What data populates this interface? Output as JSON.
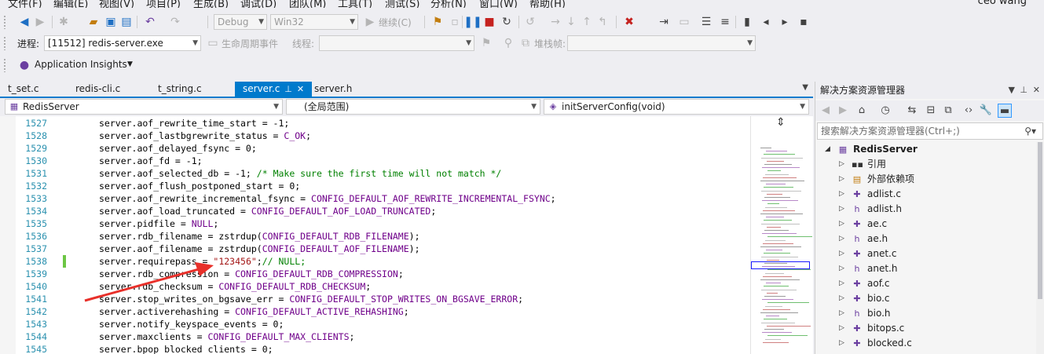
{
  "menu": {
    "items": [
      "文件(F)",
      "编辑(E)",
      "视图(V)",
      "项目(P)",
      "生成(B)",
      "调试(D)",
      "团队(M)",
      "工具(T)",
      "测试(S)",
      "分析(N)",
      "窗口(W)",
      "帮助(H)"
    ],
    "user": "ceo wang"
  },
  "toolbar": {
    "config_value": "Debug",
    "platform_value": "Win32",
    "continue_label": "继续(C)",
    "process_label": "进程:",
    "process_value": "[11512] redis-server.exe",
    "lifecycle_label": "生命周期事件",
    "thread_label": "线程:",
    "stack_label": "堆栈帧:",
    "insights_label": "Application Insights"
  },
  "tabs": [
    {
      "label": "t_set.c",
      "active": false
    },
    {
      "label": "redis-cli.c",
      "active": false
    },
    {
      "label": "t_string.c",
      "active": false
    },
    {
      "label": "server.c",
      "active": true
    },
    {
      "label": "server.h",
      "active": false
    }
  ],
  "navbar": {
    "project": "RedisServer",
    "scope": "(全局范围)",
    "function": "initServerConfig(void)"
  },
  "editor": {
    "lines": [
      {
        "num": "1527",
        "parts": [
          {
            "t": "server.aof_rewrite_time_start = -1;",
            "c": "n"
          }
        ]
      },
      {
        "num": "1528",
        "parts": [
          {
            "t": "server.aof_lastbgrewrite_status = ",
            "c": "n"
          },
          {
            "t": "C_OK",
            "c": "m"
          },
          {
            "t": ";",
            "c": "n"
          }
        ]
      },
      {
        "num": "1529",
        "parts": [
          {
            "t": "server.aof_delayed_fsync = 0;",
            "c": "n"
          }
        ]
      },
      {
        "num": "1530",
        "parts": [
          {
            "t": "server.aof_fd = -1;",
            "c": "n"
          }
        ]
      },
      {
        "num": "1531",
        "parts": [
          {
            "t": "server.aof_selected_db = -1; ",
            "c": "n"
          },
          {
            "t": "/* Make sure the first time will not match */",
            "c": "c"
          }
        ]
      },
      {
        "num": "1532",
        "parts": [
          {
            "t": "server.aof_flush_postponed_start = 0;",
            "c": "n"
          }
        ]
      },
      {
        "num": "1533",
        "parts": [
          {
            "t": "server.aof_rewrite_incremental_fsync = ",
            "c": "n"
          },
          {
            "t": "CONFIG_DEFAULT_AOF_REWRITE_INCREMENTAL_FSYNC",
            "c": "m"
          },
          {
            "t": ";",
            "c": "n"
          }
        ]
      },
      {
        "num": "1534",
        "parts": [
          {
            "t": "server.aof_load_truncated = ",
            "c": "n"
          },
          {
            "t": "CONFIG_DEFAULT_AOF_LOAD_TRUNCATED",
            "c": "m"
          },
          {
            "t": ";",
            "c": "n"
          }
        ]
      },
      {
        "num": "1535",
        "parts": [
          {
            "t": "server.pidfile = ",
            "c": "n"
          },
          {
            "t": "NULL",
            "c": "m"
          },
          {
            "t": ";",
            "c": "n"
          }
        ]
      },
      {
        "num": "1536",
        "parts": [
          {
            "t": "server.rdb_filename = zstrdup(",
            "c": "n"
          },
          {
            "t": "CONFIG_DEFAULT_RDB_FILENAME",
            "c": "m"
          },
          {
            "t": ");",
            "c": "n"
          }
        ]
      },
      {
        "num": "1537",
        "parts": [
          {
            "t": "server.aof_filename = zstrdup(",
            "c": "n"
          },
          {
            "t": "CONFIG_DEFAULT_AOF_FILENAME",
            "c": "m"
          },
          {
            "t": ");",
            "c": "n"
          }
        ]
      },
      {
        "num": "1538",
        "parts": [
          {
            "t": "server.requirepass = ",
            "c": "n"
          },
          {
            "t": "\"123456\"",
            "c": "s"
          },
          {
            "t": ";",
            "c": "n"
          },
          {
            "t": "// NULL;",
            "c": "c"
          }
        ],
        "changed": true
      },
      {
        "num": "1539",
        "parts": [
          {
            "t": "server.rdb_compression = ",
            "c": "n"
          },
          {
            "t": "CONFIG_DEFAULT_RDB_COMPRESSION",
            "c": "m"
          },
          {
            "t": ";",
            "c": "n"
          }
        ]
      },
      {
        "num": "1540",
        "parts": [
          {
            "t": "server.rdb_checksum = ",
            "c": "n"
          },
          {
            "t": "CONFIG_DEFAULT_RDB_CHECKSUM",
            "c": "m"
          },
          {
            "t": ";",
            "c": "n"
          }
        ]
      },
      {
        "num": "1541",
        "parts": [
          {
            "t": "server.stop_writes_on_bgsave_err = ",
            "c": "n"
          },
          {
            "t": "CONFIG_DEFAULT_STOP_WRITES_ON_BGSAVE_ERROR",
            "c": "m"
          },
          {
            "t": ";",
            "c": "n"
          }
        ]
      },
      {
        "num": "1542",
        "parts": [
          {
            "t": "server.activerehashing = ",
            "c": "n"
          },
          {
            "t": "CONFIG_DEFAULT_ACTIVE_REHASHING",
            "c": "m"
          },
          {
            "t": ";",
            "c": "n"
          }
        ]
      },
      {
        "num": "1543",
        "parts": [
          {
            "t": "server.notify_keyspace_events = 0;",
            "c": "n"
          }
        ]
      },
      {
        "num": "1544",
        "parts": [
          {
            "t": "server.maxclients = ",
            "c": "n"
          },
          {
            "t": "CONFIG_DEFAULT_MAX_CLIENTS",
            "c": "m"
          },
          {
            "t": ";",
            "c": "n"
          }
        ]
      },
      {
        "num": "1545",
        "parts": [
          {
            "t": "server.bpop_blocked_clients = 0;",
            "c": "n"
          }
        ]
      }
    ]
  },
  "solution_explorer": {
    "title": "解决方案资源管理器",
    "search_placeholder": "搜索解决方案资源管理器(Ctrl+;)",
    "root": "RedisServer",
    "items": [
      {
        "label": "引用",
        "icon": "references-icon"
      },
      {
        "label": "外部依赖项",
        "icon": "folder-icon"
      },
      {
        "label": "adlist.c",
        "icon": "cpp-file-icon"
      },
      {
        "label": "adlist.h",
        "icon": "header-file-icon"
      },
      {
        "label": "ae.c",
        "icon": "cpp-file-icon"
      },
      {
        "label": "ae.h",
        "icon": "header-file-icon"
      },
      {
        "label": "anet.c",
        "icon": "cpp-file-icon"
      },
      {
        "label": "anet.h",
        "icon": "header-file-icon"
      },
      {
        "label": "aof.c",
        "icon": "cpp-file-icon"
      },
      {
        "label": "bio.c",
        "icon": "cpp-file-icon"
      },
      {
        "label": "bio.h",
        "icon": "header-file-icon"
      },
      {
        "label": "bitops.c",
        "icon": "cpp-file-icon"
      },
      {
        "label": "blocked.c",
        "icon": "cpp-file-icon"
      }
    ]
  },
  "colors": {
    "accent": "#007acc",
    "macro": "#6f008a",
    "string": "#a31515",
    "comment": "#008000",
    "line_number": "#2b91af",
    "annotation_arrow": "#e8302a"
  }
}
